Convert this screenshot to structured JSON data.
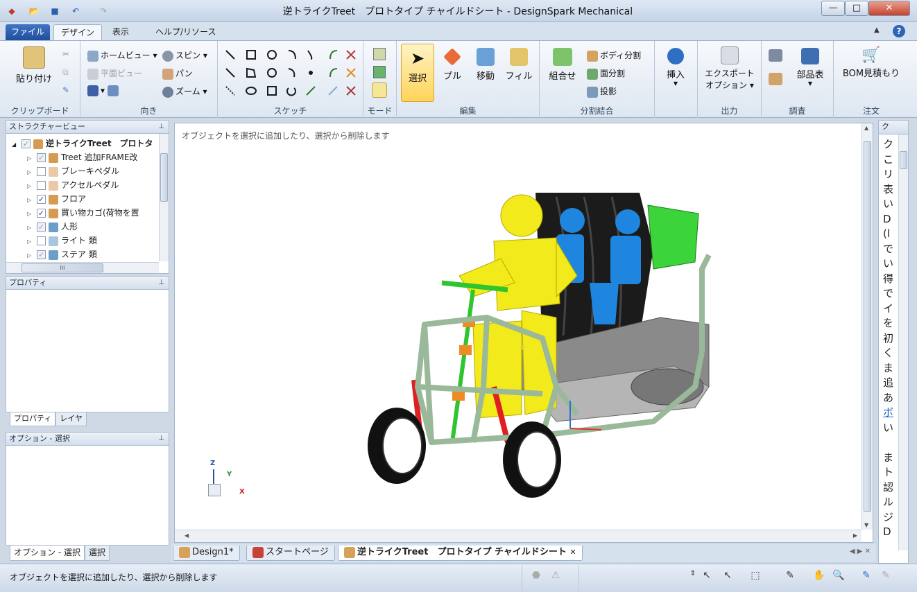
{
  "window": {
    "title": "逆トライクTreet　プロトタイプ チャイルドシート - DesignSpark Mechanical",
    "min_label": "—",
    "max_label": "□",
    "close_label": "✕"
  },
  "ribbon": {
    "tabs": {
      "file": "ファイル(F)",
      "design": "デザイン",
      "display": "表示",
      "help": "ヘルプ/リソース"
    },
    "clipboard": {
      "paste": "貼り付け",
      "label": "クリップボード"
    },
    "orient": {
      "home": "ホームビュー",
      "plane": "平面ビュー",
      "spin": "スピン",
      "pan": "パン",
      "zoom": "ズーム",
      "label": "向き"
    },
    "sketch": {
      "label": "スケッチ"
    },
    "mode": {
      "label": "モード"
    },
    "edit": {
      "select": "選択",
      "pull": "プル",
      "move": "移動",
      "fill": "フィル",
      "label": "編集"
    },
    "intersect": {
      "combine": "組合せ",
      "split_body": "ボディ分割",
      "split_face": "面分割",
      "project": "投影",
      "label": "分割結合"
    },
    "insert": {
      "insert": "挿入",
      "label": ""
    },
    "output": {
      "export1": "エクスポート",
      "export2": "オプション",
      "label": "出力"
    },
    "investigate": {
      "bom": "部品表",
      "label": "調査"
    },
    "order": {
      "bom_quote": "BOM見積もり",
      "label": "注文"
    }
  },
  "structure": {
    "header": "ストラクチャービュー",
    "root": "逆トライクTreet　プロトタ",
    "items": [
      {
        "label": "Treet 追加FRAME改",
        "checked": "✓",
        "check_style": "gray",
        "icon_color": "#d79a55"
      },
      {
        "label": "ブレーキペダル",
        "checked": "",
        "check_style": "",
        "icon_color": "#e9c9a8"
      },
      {
        "label": "アクセルペダル",
        "checked": "",
        "check_style": "",
        "icon_color": "#e9c9a8"
      },
      {
        "label": "フロア",
        "checked": "✓",
        "check_style": "",
        "icon_color": "#d79a55"
      },
      {
        "label": "買い物カゴ(荷物を置",
        "checked": "✓",
        "check_style": "",
        "icon_color": "#d79a55"
      },
      {
        "label": "人形",
        "checked": "✓",
        "check_style": "gray",
        "icon_color": "#6d9ec9"
      },
      {
        "label": "ライト 類",
        "checked": "",
        "check_style": "",
        "icon_color": "#a9c6e0"
      },
      {
        "label": "ステア 類",
        "checked": "✓",
        "check_style": "gray",
        "icon_color": "#6d9ec9"
      }
    ],
    "hscroll_glyph": "III"
  },
  "properties": {
    "header": "プロパティ",
    "tab_props": "プロパティ",
    "tab_layers": "レイヤ"
  },
  "options": {
    "header": "オプション - 選択",
    "tab_options": "オプション - 選択",
    "tab_select": "選択"
  },
  "canvas": {
    "hint": "オブジェクトを選択に追加したり、選択から削除します"
  },
  "doctabs": {
    "design1": "Design1*",
    "start": "スタートページ",
    "active": "逆トライクTreet　プロトタイプ チャイルドシート",
    "close": "✕"
  },
  "rightpane": {
    "header": "ク",
    "lines": [
      "ク",
      "こ",
      "リ",
      "表",
      "い",
      "D",
      "(l",
      "で",
      "い",
      "得",
      "で",
      "イ",
      "を",
      "初",
      "く",
      "ま",
      "追",
      "あ",
      "ボ",
      "い",
      "",
      "ま",
      "ト",
      "認",
      "ル",
      "ジ",
      "D"
    ]
  },
  "status": {
    "text": "オブジェクトを選択に追加したり、選択から削除します"
  },
  "axes": {
    "x": "X",
    "y": "Y",
    "z": "Z"
  },
  "colors": {
    "accent": "#1f4f9c",
    "frame": "#9ab89a",
    "figure_front": "#f2ea1a",
    "figure_back": "#1f86e0",
    "wheel": "#111111",
    "seat": "#1b1b1b",
    "cargo": "#3bd43b"
  }
}
